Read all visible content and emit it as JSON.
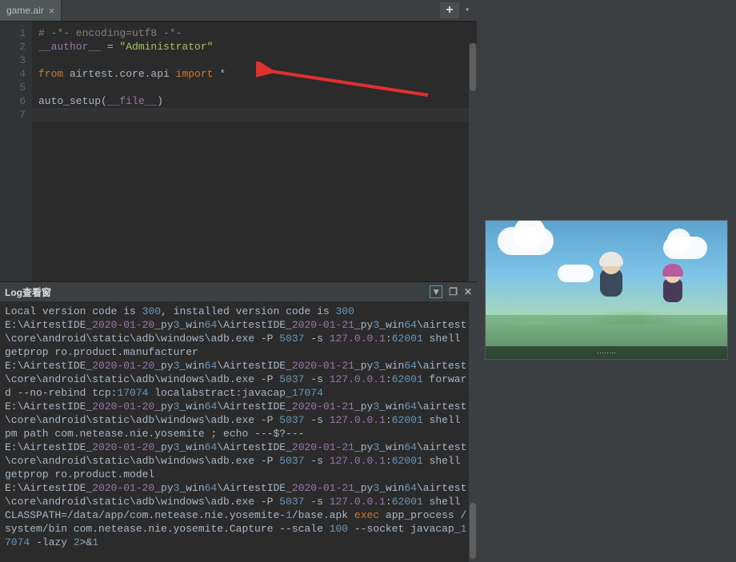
{
  "tab": {
    "filename": "game.air",
    "close_glyph": "×"
  },
  "toolbar": {
    "plus_glyph": "+",
    "dropdown_glyph": "▾"
  },
  "editor": {
    "line_numbers": [
      "1",
      "2",
      "3",
      "4",
      "5",
      "6",
      "7"
    ],
    "lines": {
      "comment": "# -*- encoding=utf8 -*-",
      "author_var": "__author__",
      "eq": " = ",
      "author_val": "\"Administrator\"",
      "from_kw": "from",
      "module": " airtest.core.api ",
      "import_kw": "import",
      "star": " *",
      "func": "auto_setup(",
      "file_var": "__file__",
      "close_paren": ")"
    }
  },
  "log": {
    "title": "Log查看窗",
    "filter_glyph": "▼",
    "restore_glyph": "❐",
    "close_glyph": "✕",
    "lines": [
      [
        {
          "t": "text",
          "v": "Local version code is "
        },
        {
          "t": "num",
          "v": "300"
        },
        {
          "t": "text",
          "v": ", installed version code is "
        },
        {
          "t": "num",
          "v": "300"
        }
      ],
      [
        {
          "t": "text",
          "v": "E:\\AirtestIDE_"
        },
        {
          "t": "path",
          "v": "2020-01-20"
        },
        {
          "t": "text",
          "v": "_py"
        },
        {
          "t": "num",
          "v": "3"
        },
        {
          "t": "text",
          "v": "_win"
        },
        {
          "t": "num",
          "v": "64"
        },
        {
          "t": "text",
          "v": "\\AirtestIDE_"
        },
        {
          "t": "path",
          "v": "2020-01-21"
        },
        {
          "t": "text",
          "v": "_py"
        },
        {
          "t": "num",
          "v": "3"
        },
        {
          "t": "text",
          "v": "_win"
        },
        {
          "t": "num",
          "v": "64"
        },
        {
          "t": "text",
          "v": "\\airtest\\core\\android\\static\\adb\\windows\\adb.exe -P "
        },
        {
          "t": "num",
          "v": "5037"
        },
        {
          "t": "text",
          "v": " -s "
        },
        {
          "t": "path",
          "v": "127.0.0.1"
        },
        {
          "t": "text",
          "v": ":"
        },
        {
          "t": "num",
          "v": "62001"
        },
        {
          "t": "text",
          "v": " shell getprop ro.product.manufacturer"
        }
      ],
      [
        {
          "t": "text",
          "v": "E:\\AirtestIDE_"
        },
        {
          "t": "path",
          "v": "2020-01-20"
        },
        {
          "t": "text",
          "v": "_py"
        },
        {
          "t": "num",
          "v": "3"
        },
        {
          "t": "text",
          "v": "_win"
        },
        {
          "t": "num",
          "v": "64"
        },
        {
          "t": "text",
          "v": "\\AirtestIDE_"
        },
        {
          "t": "path",
          "v": "2020-01-21"
        },
        {
          "t": "text",
          "v": "_py"
        },
        {
          "t": "num",
          "v": "3"
        },
        {
          "t": "text",
          "v": "_win"
        },
        {
          "t": "num",
          "v": "64"
        },
        {
          "t": "text",
          "v": "\\airtest\\core\\android\\static\\adb\\windows\\adb.exe -P "
        },
        {
          "t": "num",
          "v": "5037"
        },
        {
          "t": "text",
          "v": " -s "
        },
        {
          "t": "path",
          "v": "127.0.0.1"
        },
        {
          "t": "text",
          "v": ":"
        },
        {
          "t": "num",
          "v": "62001"
        },
        {
          "t": "text",
          "v": " forward --no-rebind tcp:"
        },
        {
          "t": "num",
          "v": "17074"
        },
        {
          "t": "text",
          "v": " localabstract:javacap_"
        },
        {
          "t": "num",
          "v": "17074"
        }
      ],
      [
        {
          "t": "text",
          "v": "E:\\AirtestIDE_"
        },
        {
          "t": "path",
          "v": "2020-01-20"
        },
        {
          "t": "text",
          "v": "_py"
        },
        {
          "t": "num",
          "v": "3"
        },
        {
          "t": "text",
          "v": "_win"
        },
        {
          "t": "num",
          "v": "64"
        },
        {
          "t": "text",
          "v": "\\AirtestIDE_"
        },
        {
          "t": "path",
          "v": "2020-01-21"
        },
        {
          "t": "text",
          "v": "_py"
        },
        {
          "t": "num",
          "v": "3"
        },
        {
          "t": "text",
          "v": "_win"
        },
        {
          "t": "num",
          "v": "64"
        },
        {
          "t": "text",
          "v": "\\airtest\\core\\android\\static\\adb\\windows\\adb.exe -P "
        },
        {
          "t": "num",
          "v": "5037"
        },
        {
          "t": "text",
          "v": " -s "
        },
        {
          "t": "path",
          "v": "127.0.0.1"
        },
        {
          "t": "text",
          "v": ":"
        },
        {
          "t": "num",
          "v": "62001"
        },
        {
          "t": "text",
          "v": " shell pm path com.netease.nie.yosemite ; echo ---$?---"
        }
      ],
      [
        {
          "t": "text",
          "v": "E:\\AirtestIDE_"
        },
        {
          "t": "path",
          "v": "2020-01-20"
        },
        {
          "t": "text",
          "v": "_py"
        },
        {
          "t": "num",
          "v": "3"
        },
        {
          "t": "text",
          "v": "_win"
        },
        {
          "t": "num",
          "v": "64"
        },
        {
          "t": "text",
          "v": "\\AirtestIDE_"
        },
        {
          "t": "path",
          "v": "2020-01-21"
        },
        {
          "t": "text",
          "v": "_py"
        },
        {
          "t": "num",
          "v": "3"
        },
        {
          "t": "text",
          "v": "_win"
        },
        {
          "t": "num",
          "v": "64"
        },
        {
          "t": "text",
          "v": "\\airtest\\core\\android\\static\\adb\\windows\\adb.exe -P "
        },
        {
          "t": "num",
          "v": "5037"
        },
        {
          "t": "text",
          "v": " -s "
        },
        {
          "t": "path",
          "v": "127.0.0.1"
        },
        {
          "t": "text",
          "v": ":"
        },
        {
          "t": "num",
          "v": "62001"
        },
        {
          "t": "text",
          "v": " shell getprop ro.product.model"
        }
      ],
      [
        {
          "t": "text",
          "v": "E:\\AirtestIDE_"
        },
        {
          "t": "path",
          "v": "2020-01-20"
        },
        {
          "t": "text",
          "v": "_py"
        },
        {
          "t": "num",
          "v": "3"
        },
        {
          "t": "text",
          "v": "_win"
        },
        {
          "t": "num",
          "v": "64"
        },
        {
          "t": "text",
          "v": "\\AirtestIDE_"
        },
        {
          "t": "path",
          "v": "2020-01-21"
        },
        {
          "t": "text",
          "v": "_py"
        },
        {
          "t": "num",
          "v": "3"
        },
        {
          "t": "text",
          "v": "_win"
        },
        {
          "t": "num",
          "v": "64"
        },
        {
          "t": "text",
          "v": "\\airtest\\core\\android\\static\\adb\\windows\\adb.exe -P "
        },
        {
          "t": "num",
          "v": "5037"
        },
        {
          "t": "text",
          "v": " -s "
        },
        {
          "t": "path",
          "v": "127.0.0.1"
        },
        {
          "t": "text",
          "v": ":"
        },
        {
          "t": "num",
          "v": "62001"
        },
        {
          "t": "text",
          "v": " shell CLASSPATH=/data/app/com.netease.nie.yosemite-"
        },
        {
          "t": "num",
          "v": "1"
        },
        {
          "t": "text",
          "v": "/base.apk "
        },
        {
          "t": "exec",
          "v": "exec"
        },
        {
          "t": "text",
          "v": " app_process /system/bin com.netease.nie.yosemite.Capture --scale "
        },
        {
          "t": "num",
          "v": "100"
        },
        {
          "t": "text",
          "v": " --socket javacap_"
        },
        {
          "t": "num",
          "v": "17074"
        },
        {
          "t": "text",
          "v": " -lazy "
        },
        {
          "t": "num",
          "v": "2"
        },
        {
          "t": "text",
          "v": ">&"
        },
        {
          "t": "num",
          "v": "1"
        }
      ]
    ]
  },
  "preview": {
    "footer_text": "········"
  }
}
